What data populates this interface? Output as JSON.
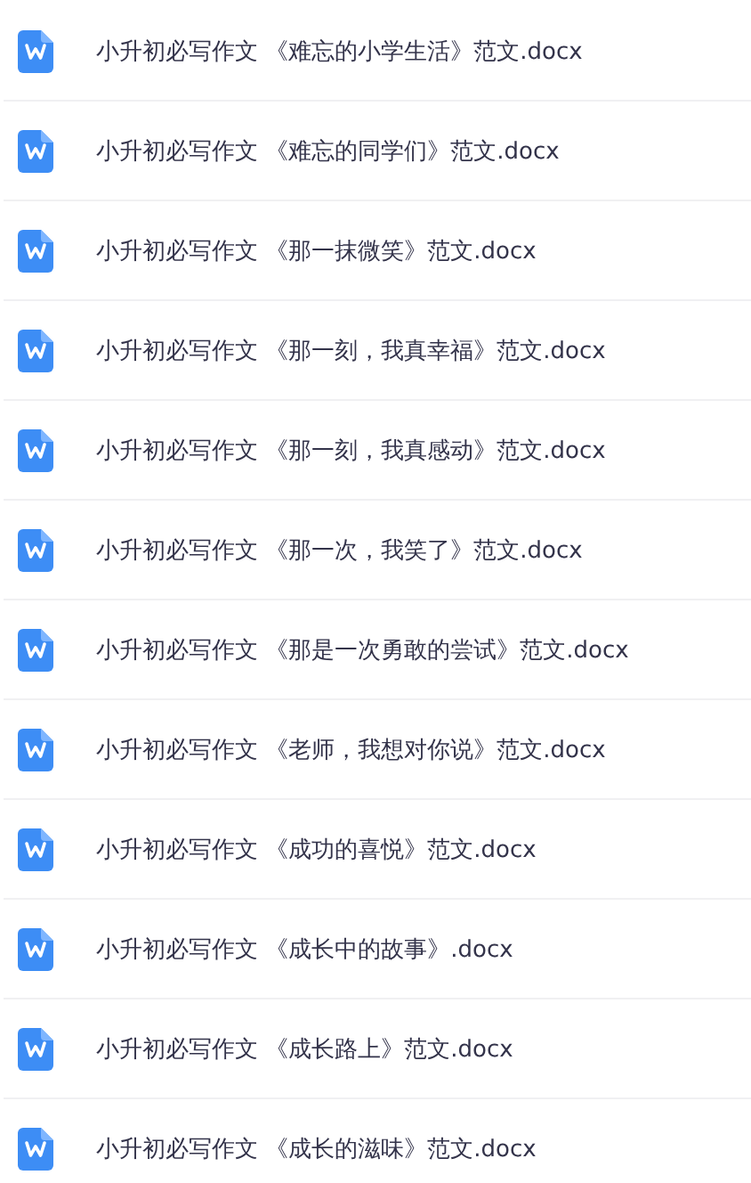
{
  "files": [
    {
      "name": "小升初必写作文 《难忘的小学生活》范文.docx"
    },
    {
      "name": "小升初必写作文 《难忘的同学们》范文.docx"
    },
    {
      "name": "小升初必写作文 《那一抹微笑》范文.docx"
    },
    {
      "name": "小升初必写作文 《那一刻，我真幸福》范文.docx"
    },
    {
      "name": "小升初必写作文 《那一刻，我真感动》范文.docx"
    },
    {
      "name": "小升初必写作文 《那一次，我笑了》范文.docx"
    },
    {
      "name": "小升初必写作文 《那是一次勇敢的尝试》范文.docx"
    },
    {
      "name": "小升初必写作文 《老师，我想对你说》范文.docx"
    },
    {
      "name": "小升初必写作文 《成功的喜悦》范文.docx"
    },
    {
      "name": "小升初必写作文 《成长中的故事》.docx"
    },
    {
      "name": "小升初必写作文 《成长路上》范文.docx"
    },
    {
      "name": "小升初必写作文 《成长的滋味》范文.docx"
    }
  ]
}
